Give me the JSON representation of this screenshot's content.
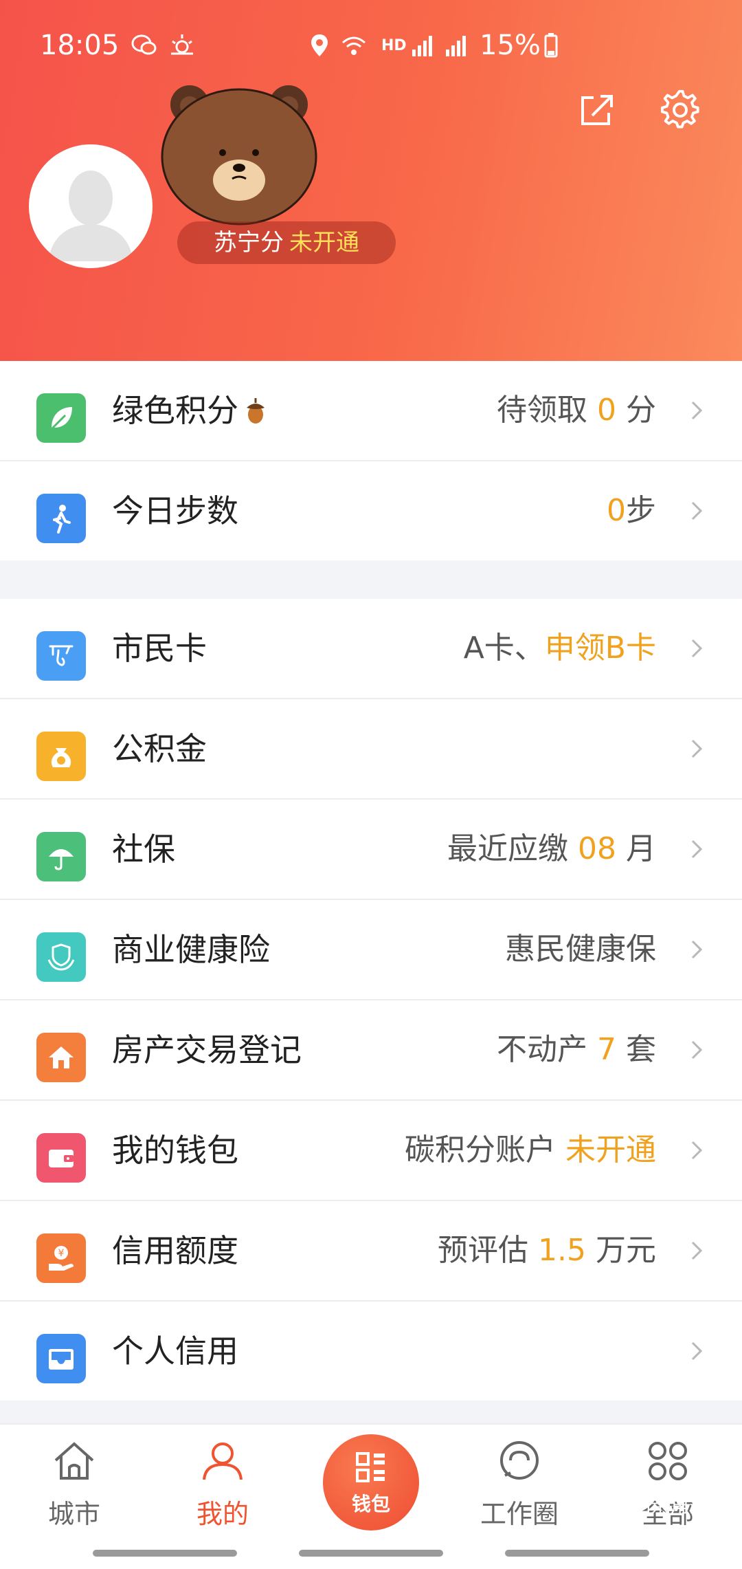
{
  "status_bar": {
    "time": "18:05",
    "network": "HD",
    "battery": "15%"
  },
  "profile": {
    "suning_label": "苏宁分",
    "suning_status": "未开通"
  },
  "group1": [
    {
      "label": "绿色积分",
      "value_pre": "待领取 ",
      "value_hl": "0",
      "value_post": " 分",
      "icon": "leaf-icon",
      "color": "#4cbf6e"
    },
    {
      "label": "今日步数",
      "value_pre": "",
      "value_hl": "0",
      "value_post": "步",
      "icon": "walking-icon",
      "color": "#3f8ef0"
    }
  ],
  "group2": [
    {
      "label": "市民卡",
      "value_pre": "A卡、",
      "value_hl": "申领B卡",
      "value_post": "",
      "icon": "citizen-card-icon",
      "color": "#4a9ff5"
    },
    {
      "label": "公积金",
      "value_pre": "",
      "value_hl": "",
      "value_post": "",
      "icon": "fund-bag-icon",
      "color": "#f7b12a"
    },
    {
      "label": "社保",
      "value_pre": "最近应缴 ",
      "value_hl": "08",
      "value_post": " 月",
      "icon": "umbrella-icon",
      "color": "#4cc07a"
    },
    {
      "label": "商业健康险",
      "value_pre": "惠民健康保",
      "value_hl": "",
      "value_post": "",
      "icon": "shield-hands-icon",
      "color": "#43c9c0"
    },
    {
      "label": "房产交易登记",
      "value_pre": "不动产 ",
      "value_hl": "7",
      "value_post": " 套",
      "icon": "house-icon",
      "color": "#f47e3c"
    },
    {
      "label": "我的钱包",
      "value_pre": "碳积分账户 ",
      "value_hl": "未开通",
      "value_post": "",
      "icon": "wallet-icon",
      "color": "#f0566e"
    },
    {
      "label": "信用额度",
      "value_pre": "预评估 ",
      "value_hl": "1.5",
      "value_post": " 万元",
      "icon": "money-hand-icon",
      "color": "#f47a3a"
    },
    {
      "label": "个人信用",
      "value_pre": "",
      "value_hl": "",
      "value_post": "",
      "icon": "inbox-icon",
      "color": "#3f8ef0"
    }
  ],
  "nav": {
    "city": "城市",
    "mine": "我的",
    "wallet": "钱包",
    "work": "工作圈",
    "all": "全部"
  },
  "watermark": "相亲角落",
  "colors": {
    "accent": "#f0532f",
    "highlight": "#f0a21e",
    "header_start": "#f5534a",
    "header_end": "#fb8a5c"
  }
}
